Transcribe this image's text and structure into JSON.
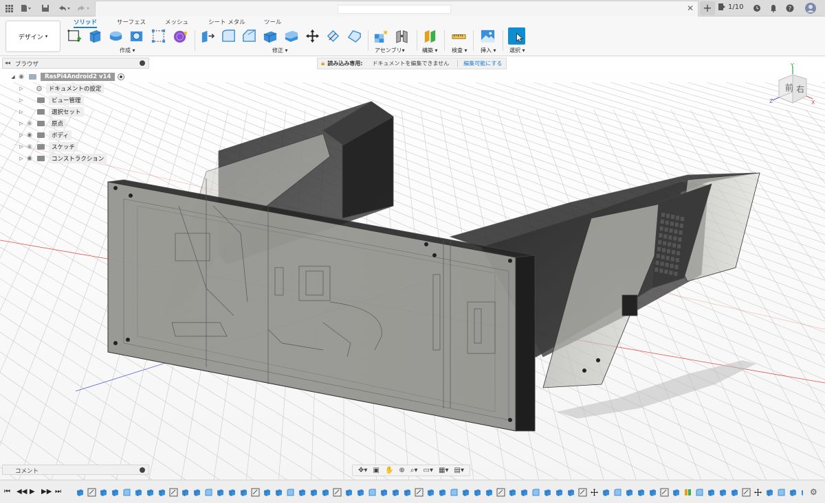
{
  "titlebar": {
    "document_title": "",
    "job_status": "1/10",
    "icons": [
      "grid-icon",
      "file-icon",
      "save-icon",
      "undo-icon",
      "redo-icon",
      "close-icon",
      "plus-icon",
      "jobs-icon",
      "clock-icon",
      "bell-icon",
      "help-icon",
      "user-icon"
    ]
  },
  "toolbar": {
    "workspace": "デザイン",
    "tabs": [
      "ソリッド",
      "サーフェス",
      "メッシュ",
      "シート メタル",
      "ツール"
    ],
    "groups": {
      "create": "作成",
      "modify": "修正",
      "assemble": "アセンブリ",
      "construct": "構築",
      "inspect": "検査",
      "insert": "挿入",
      "select": "選択"
    },
    "accent_color": "#1b7fd1",
    "select_color": "#0e8ed1"
  },
  "browser": {
    "title": "ブラウザ",
    "root": "RasPi4Android2 v14",
    "items": [
      {
        "label": "ドキュメントの設定",
        "icon": "gear-icon"
      },
      {
        "label": "ビュー管理",
        "icon": "folder-icon"
      },
      {
        "label": "選択セット",
        "icon": "folder-icon"
      },
      {
        "label": "原点",
        "icon": "folder-icon"
      },
      {
        "label": "ボディ",
        "icon": "folder-icon"
      },
      {
        "label": "スケッチ",
        "icon": "folder-icon"
      },
      {
        "label": "コンストラクション",
        "icon": "folder-icon"
      }
    ]
  },
  "banner": {
    "readonly": "読み込み専用:",
    "message": "ドキュメントを編集できません",
    "action": "編集可能にする"
  },
  "viewcube": {
    "front": "前",
    "right": "右",
    "axis_x": "X",
    "axis_y": "Y",
    "axis_z": "Z"
  },
  "comments": {
    "title": "コメント"
  },
  "navbar": {
    "icons": [
      "orbit-icon",
      "camera-icon",
      "pan-icon",
      "zoom-icon",
      "zoom-window-icon",
      "display-icon",
      "visual-style-icon",
      "grid-settings-icon"
    ]
  },
  "timeline": {
    "count": 74
  }
}
